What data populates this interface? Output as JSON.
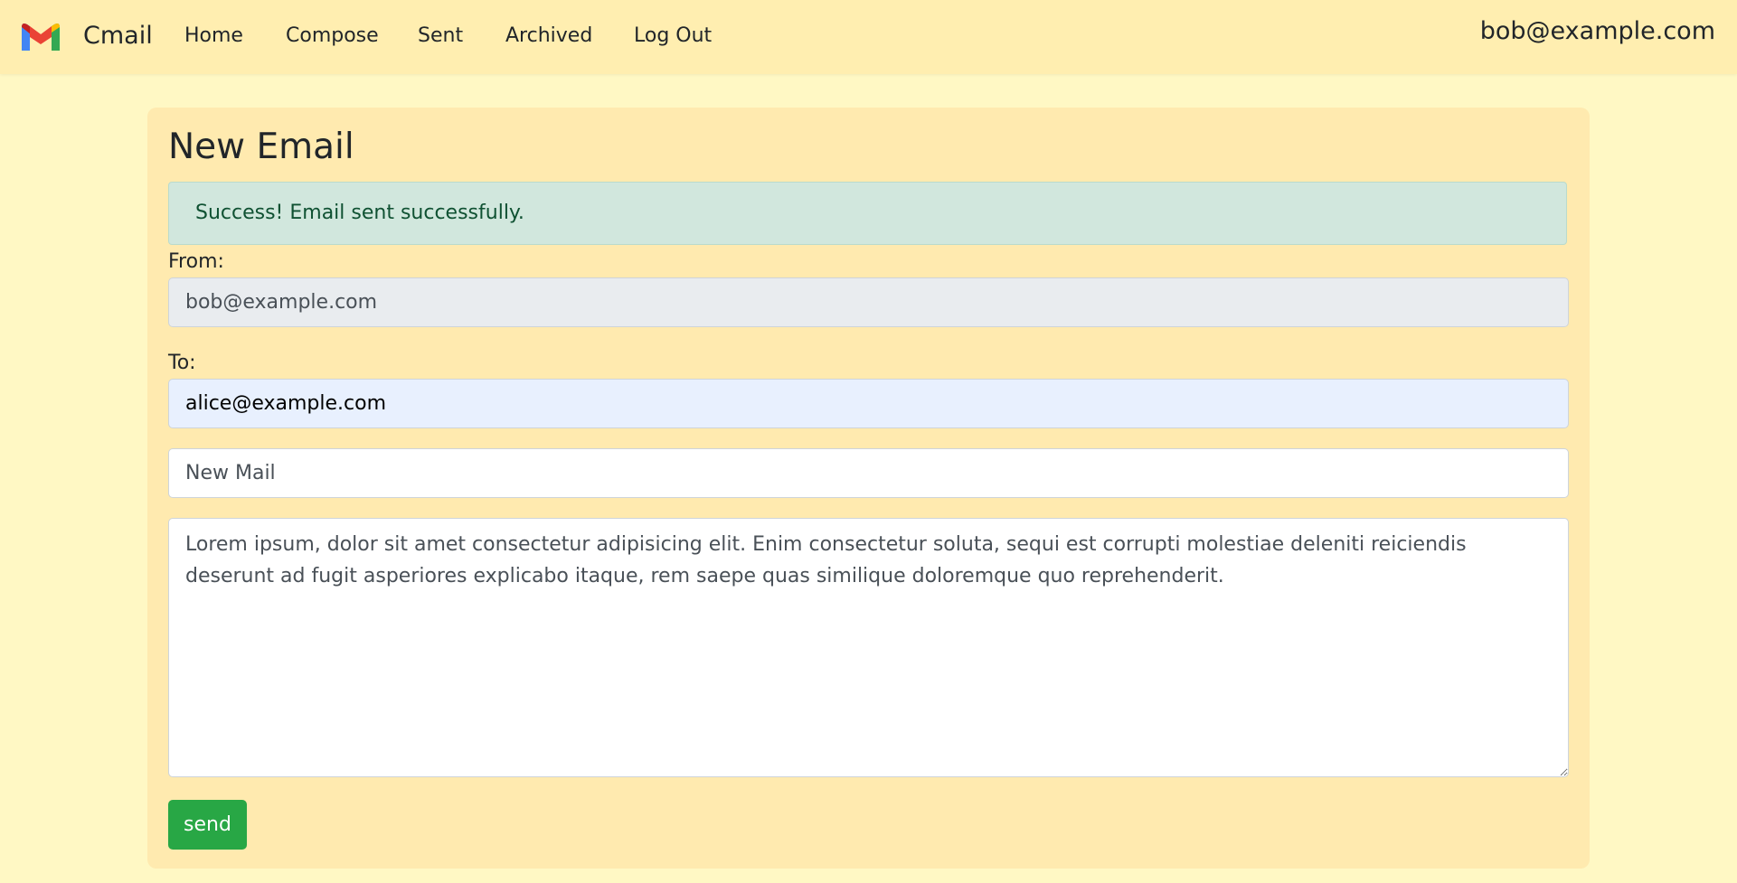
{
  "navbar": {
    "brand": "Cmail",
    "links": [
      "Home",
      "Compose",
      "Sent",
      "Archived",
      "Log Out"
    ],
    "user_email": "bob@example.com"
  },
  "page": {
    "title": "New Email"
  },
  "alert": {
    "text": "Success! Email sent successfully."
  },
  "form": {
    "from_label": "From:",
    "from_value": "bob@example.com",
    "to_label": "To:",
    "to_value": "alice@example.com",
    "subject_value": "New Mail",
    "body_value": "Lorem ipsum, dolor sit amet consectetur adipisicing elit. Enim consectetur soluta, sequi est corrupti molestiae deleniti reiciendis deserunt ad fugit asperiores explicabo itaque, rem saepe quas similique doloremque quo reprehenderit.",
    "send_label": "send"
  },
  "icons": {
    "logo": "gmail-logo-icon"
  },
  "colors": {
    "page_background": "#fff8c4",
    "navbar_background": "#ffeeb0",
    "card_background": "#ffeaaf",
    "alert_background": "#d1e7dd",
    "alert_text": "#0f5132",
    "send_button": "#28a745"
  }
}
